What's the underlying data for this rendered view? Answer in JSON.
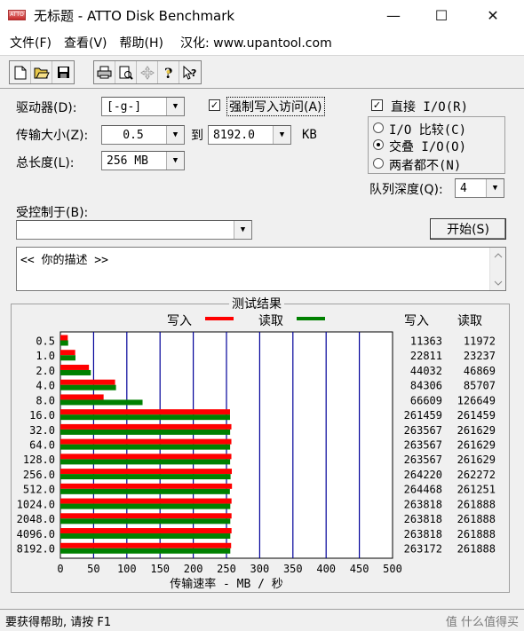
{
  "window": {
    "title": "无标题 - ATTO Disk Benchmark",
    "icon_text": "ATTO",
    "minimize": "—",
    "maximize": "☐",
    "close": "✕"
  },
  "menu": {
    "file": "文件(F)",
    "view": "查看(V)",
    "help": "帮助(H)",
    "credit": "汉化: www.upantool.com"
  },
  "toolbar": {
    "icons": [
      "new-icon",
      "open-icon",
      "save-icon",
      "print-icon",
      "print-preview-icon",
      "move-icon",
      "help-icon",
      "context-help-icon"
    ]
  },
  "controls": {
    "drive_label": "驱动器(D):",
    "drive_value": "[-g-]",
    "force_write_label": "强制写入访问(A)",
    "force_write_checked": true,
    "transfer_label": "传输大小(Z):",
    "transfer_from": "0.5",
    "to_label": "到",
    "transfer_to": "8192.0",
    "kb_label": "KB",
    "total_label": "总长度(L):",
    "total_value": "256 MB",
    "direct_io_label": "直接 I/O(R)",
    "direct_io_checked": true,
    "io_compare_label": "I/O 比较(C)",
    "overlap_io_label": "交叠 I/O(O)",
    "neither_label": "两者都不(N)",
    "io_selected": "overlap",
    "queue_label": "队列深度(Q):",
    "queue_value": "4",
    "controlled_label": "受控制于(B):",
    "controlled_value": "",
    "start_button": "开始(S)",
    "description": "<<  你的描述  >>"
  },
  "results": {
    "section_title": "测试结果",
    "write_legend": "写入",
    "read_legend": "读取",
    "write_header": "写入",
    "read_header": "读取"
  },
  "chart_data": {
    "type": "bar",
    "orientation": "horizontal",
    "title": "测试结果",
    "xlabel": "传输速率 - MB / 秒",
    "xlim": [
      0,
      500
    ],
    "xticks": [
      0,
      50,
      100,
      150,
      200,
      250,
      300,
      350,
      400,
      450,
      500
    ],
    "categories": [
      "0.5",
      "1.0",
      "2.0",
      "4.0",
      "8.0",
      "16.0",
      "32.0",
      "64.0",
      "128.0",
      "256.0",
      "512.0",
      "1024.0",
      "2048.0",
      "4096.0",
      "8192.0"
    ],
    "series": [
      {
        "name": "写入",
        "color": "#ff0000",
        "values_kb": [
          11363,
          22811,
          44032,
          84306,
          66609,
          261459,
          263567,
          263567,
          263567,
          264220,
          264468,
          263818,
          263818,
          263818,
          263172
        ]
      },
      {
        "name": "读取",
        "color": "#008000",
        "values_kb": [
          11972,
          23237,
          46869,
          85707,
          126649,
          261459,
          261629,
          261629,
          261629,
          262272,
          261251,
          261888,
          261888,
          261888,
          261888
        ]
      }
    ],
    "grid": true
  },
  "status": {
    "text": "要获得帮助, 请按 F1",
    "watermark": "值 什么值得买"
  },
  "colors": {
    "write": "#ff0000",
    "read": "#008000",
    "grid_line": "#000099",
    "face": "#f0f0f0"
  }
}
